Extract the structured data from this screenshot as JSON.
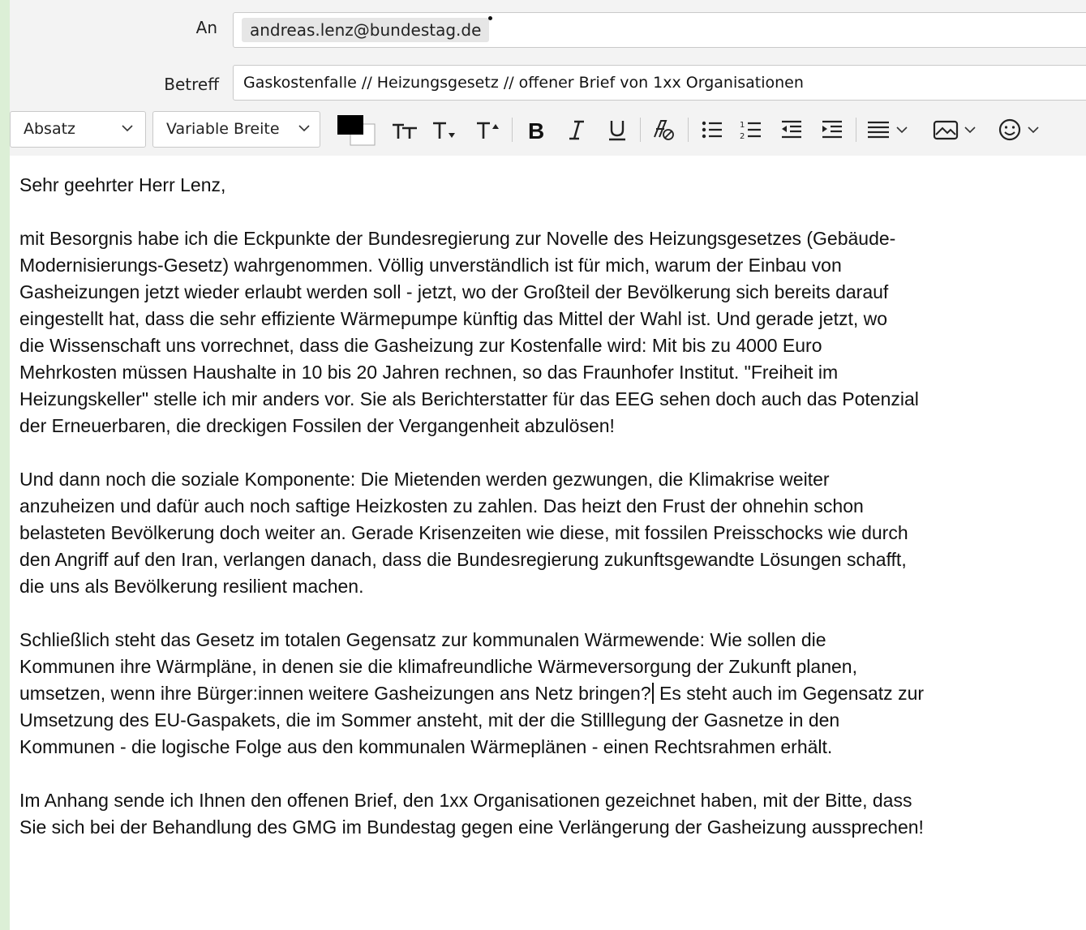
{
  "compose": {
    "to_label": "An",
    "to_recipient": "andreas.lenz@bundestag.de",
    "subject_label": "Betreff",
    "subject_value": "Gaskostenfalle // Heizungsgesetz // offener Brief von 1xx Organisationen"
  },
  "toolbar": {
    "paragraph_format": "Absatz",
    "font_width": "Variable Breite",
    "text_color": "#000000",
    "icons": [
      "text-color-icon",
      "font-size-normal-icon",
      "font-size-smaller-icon",
      "font-size-larger-icon",
      "bold-icon",
      "italic-icon",
      "underline-icon",
      "remove-formatting-icon",
      "bullet-list-icon",
      "numbered-list-icon",
      "outdent-icon",
      "indent-icon",
      "align-icon",
      "insert-image-icon",
      "emoji-icon"
    ]
  },
  "message": {
    "greeting": "Sehr geehrter Herr Lenz,",
    "para1": "mit Besorgnis habe ich die Eckpunkte der Bundesregierung zur Novelle des Heizungsgesetzes (Gebäude-\nModernisierungs-Gesetz) wahrgenommen. Völlig unverständlich ist für mich, warum der Einbau von\nGasheizungen jetzt wieder erlaubt werden soll - jetzt, wo der Großteil der Bevölkerung sich bereits darauf\neingestellt hat, dass die sehr effiziente Wärmepumpe künftig das Mittel der Wahl ist. Und gerade jetzt, wo\ndie Wissenschaft uns vorrechnet, dass die Gasheizung zur Kostenfalle wird: Mit bis zu 4000 Euro\nMehrkosten müssen Haushalte in 10 bis 20 Jahren rechnen, so das Fraunhofer Institut. \"Freiheit im\nHeizungskeller\" stelle ich mir anders vor. Sie als Berichterstatter für das EEG sehen doch auch das Potenzial\nder Erneuerbaren, die dreckigen Fossilen der Vergangenheit abzulösen!",
    "para2": "Und dann noch die soziale Komponente: Die Mietenden werden gezwungen, die Klimakrise weiter\nanzuheizen und dafür auch noch saftige Heizkosten zu zahlen. Das heizt den Frust der ohnehin schon\nbelasteten Bevölkerung doch weiter an. Gerade Krisenzeiten wie diese, mit fossilen Preisschocks wie durch\nden Angriff auf den Iran, verlangen danach, dass die Bundesregierung zukunftsgewandte Lösungen schafft,\ndie uns als Bevölkerung resilient machen.",
    "para3a": "Schließlich steht das Gesetz im totalen Gegensatz zur kommunalen Wärmewende: Wie sollen die\nKommunen ihre Wärmpläne, in denen sie die klimafreundliche Wärmeversorgung der Zukunft planen,\numsetzen, wenn ihre Bürger:innen weitere Gasheizungen ans Netz bringen?",
    "para3b": " Es steht auch im Gegensatz zur\nUmsetzung des EU-Gaspakets, die im Sommer ansteht, mit der die Stilllegung der Gasnetze in den\nKommunen - die logische Folge aus den kommunalen Wärmeplänen - einen Rechtsrahmen erhält.",
    "para4": "Im Anhang sende ich Ihnen den offenen Brief, den 1xx Organisationen gezeichnet haben, mit der Bitte, dass\nSie sich bei der Behandlung des GMG im Bundestag gegen eine Verlängerung der Gasheizung aussprechen!"
  }
}
